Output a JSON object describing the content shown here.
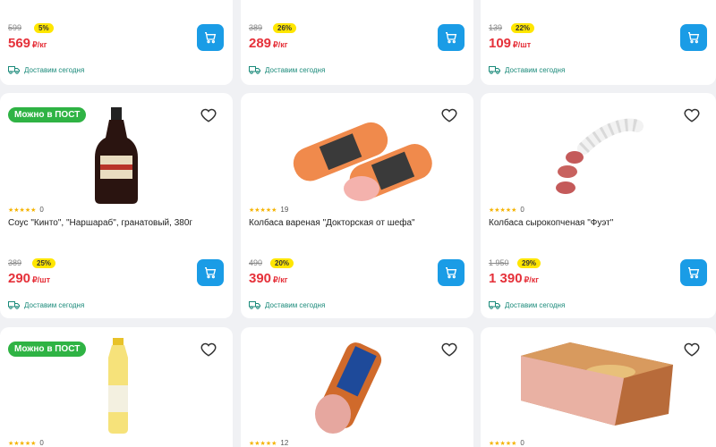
{
  "row0": [
    {
      "old": "599",
      "disc": "5%",
      "price": "569",
      "unit": "₽/кг",
      "delivery": "Доставим сегодня"
    },
    {
      "old": "389",
      "disc": "26%",
      "price": "289",
      "unit": "₽/кг",
      "delivery": "Доставим сегодня"
    },
    {
      "old": "139",
      "disc": "22%",
      "price": "109",
      "unit": "₽/шт",
      "delivery": "Доставим сегодня"
    }
  ],
  "row1": [
    {
      "badge": "Можно в ПОСТ",
      "rating": "0",
      "title": "Соус \"Кинто\", \"Наршараб\", гранатовый, 380г",
      "old": "389",
      "disc": "25%",
      "price": "290",
      "unit": "₽/шт",
      "delivery": "Доставим сегодня",
      "icon": "sauce-bottle"
    },
    {
      "rating": "19",
      "title": "Колбаса вареная \"Докторская от шефа\"",
      "old": "490",
      "disc": "20%",
      "price": "390",
      "unit": "₽/кг",
      "delivery": "Доставим сегодня",
      "icon": "boiled-sausage"
    },
    {
      "rating": "0",
      "title": "Колбаса сырокопченая \"Фуэт\"",
      "old": "1 950",
      "disc": "29%",
      "price": "1 390",
      "unit": "₽/кг",
      "delivery": "Доставим сегодня",
      "icon": "dry-sausage"
    }
  ],
  "row2": [
    {
      "badge": "Можно в ПОСТ",
      "rating": "0",
      "icon": "oil-bottle"
    },
    {
      "rating": "12",
      "icon": "ham-roll"
    },
    {
      "rating": "0",
      "icon": "smoked-meat"
    }
  ],
  "colors": {
    "price": "#e5313a",
    "cart": "#1a9ce6",
    "badge": "#2fb344",
    "discount": "#ffe600"
  }
}
